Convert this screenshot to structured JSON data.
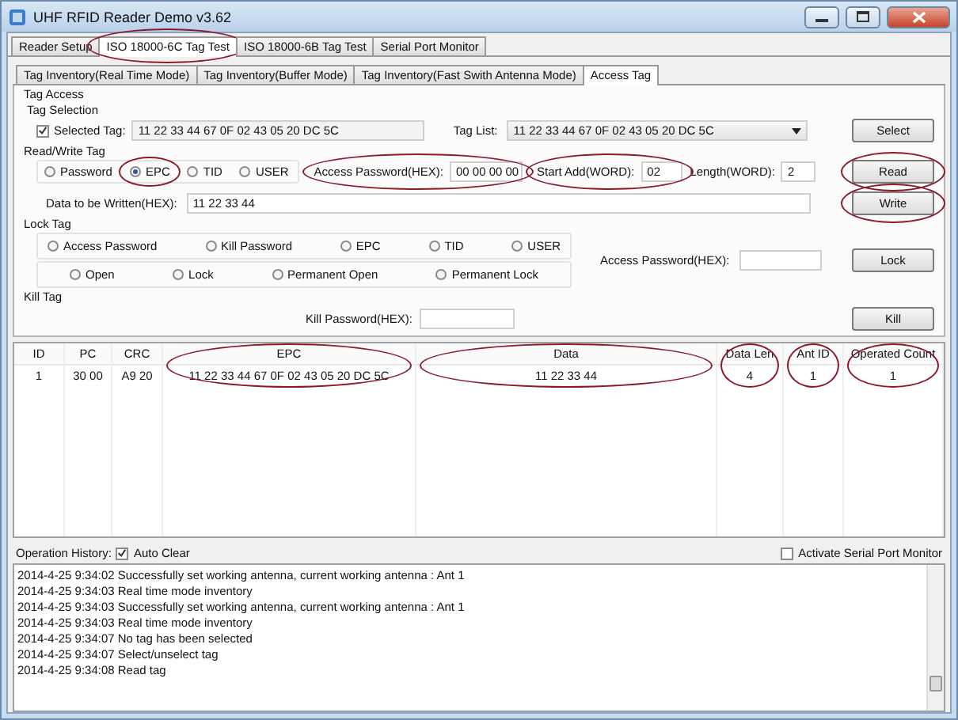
{
  "window": {
    "title": "UHF RFID Reader Demo v3.62"
  },
  "tabs": [
    {
      "label": "Reader Setup",
      "selected": false,
      "circled": false
    },
    {
      "label": "ISO 18000-6C Tag Test",
      "selected": true,
      "circled": true
    },
    {
      "label": "ISO 18000-6B Tag Test",
      "selected": false,
      "circled": false
    },
    {
      "label": "Serial Port Monitor",
      "selected": false,
      "circled": false
    }
  ],
  "subtabs": [
    {
      "label": "Tag Inventory(Real Time Mode)",
      "selected": false
    },
    {
      "label": "Tag Inventory(Buffer Mode)",
      "selected": false
    },
    {
      "label": "Tag Inventory(Fast Swith Antenna Mode)",
      "selected": false
    },
    {
      "label": "Access Tag",
      "selected": true
    }
  ],
  "section_title": "Tag Access",
  "tag_selection": {
    "title": "Tag Selection",
    "checkbox": {
      "label": "Selected Tag:",
      "checked": true
    },
    "value": "11 22 33 44 67 0F 02 43 05 20 DC 5C",
    "list_label": "Tag List:",
    "list_value": "11 22 33 44 67 0F 02 43 05 20 DC 5C",
    "button": "Select"
  },
  "read_write": {
    "title": "Read/Write Tag",
    "banks": [
      {
        "label": "Password",
        "selected": false,
        "circled": false
      },
      {
        "label": "EPC",
        "selected": true,
        "circled": true
      },
      {
        "label": "TID",
        "selected": false,
        "circled": false
      },
      {
        "label": "USER",
        "selected": false,
        "circled": false
      }
    ],
    "fields": [
      {
        "label": "Access Password(HEX):",
        "value": "00 00 00 00",
        "circled": true
      },
      {
        "label": "Start Add(WORD):",
        "value": "02",
        "circled": true
      },
      {
        "label": "Length(WORD):",
        "value": "2",
        "circled": false
      }
    ],
    "read_button": {
      "label": "Read",
      "circled": true
    },
    "data_label": "Data to be Written(HEX):",
    "data_value": "11 22 33 44",
    "write_button": {
      "label": "Write",
      "circled": true
    }
  },
  "lock": {
    "title": "Lock Tag",
    "areas": [
      {
        "label": "Access Password",
        "selected": false
      },
      {
        "label": "Kill Password",
        "selected": false
      },
      {
        "label": "EPC",
        "selected": false
      },
      {
        "label": "TID",
        "selected": false
      },
      {
        "label": "USER",
        "selected": false
      }
    ],
    "types": [
      {
        "label": "Open",
        "selected": false
      },
      {
        "label": "Lock",
        "selected": false
      },
      {
        "label": "Permanent Open",
        "selected": false
      },
      {
        "label": "Permanent Lock",
        "selected": false
      }
    ],
    "password_label": "Access Password(HEX):",
    "button": "Lock"
  },
  "kill": {
    "title": "Kill Tag",
    "password_label": "Kill Password(HEX):",
    "button": "Kill"
  },
  "table": {
    "columns": [
      {
        "label": "ID",
        "circled": false
      },
      {
        "label": "PC",
        "circled": false
      },
      {
        "label": "CRC",
        "circled": false
      },
      {
        "label": "EPC",
        "circled": true
      },
      {
        "label": "Data",
        "circled": true
      },
      {
        "label": "Data Len",
        "circled": true
      },
      {
        "label": "Ant ID",
        "circled": true
      },
      {
        "label": "Operated Count",
        "circled": true
      }
    ],
    "rows": [
      [
        "1",
        "30 00",
        "A9 20",
        "11 22 33 44 67 0F 02 43 05 20 DC 5C",
        "11 22 33 44",
        "4",
        "1",
        "1"
      ]
    ]
  },
  "history": {
    "label": "Operation History:",
    "auto_clear": {
      "label": "Auto Clear",
      "checked": true
    },
    "serial_monitor": {
      "label": "Activate Serial Port Monitor",
      "checked": false
    },
    "log": [
      "2014-4-25 9:34:02 Successfully set working antenna, current working antenna : Ant 1",
      "2014-4-25 9:34:03 Real time mode inventory",
      "2014-4-25 9:34:03 Successfully set working antenna, current working antenna : Ant 1",
      "2014-4-25 9:34:03 Real time mode inventory",
      "2014-4-25 9:34:07 No tag has been selected",
      "2014-4-25 9:34:07 Select/unselect tag",
      "2014-4-25 9:34:08 Read tag"
    ]
  }
}
